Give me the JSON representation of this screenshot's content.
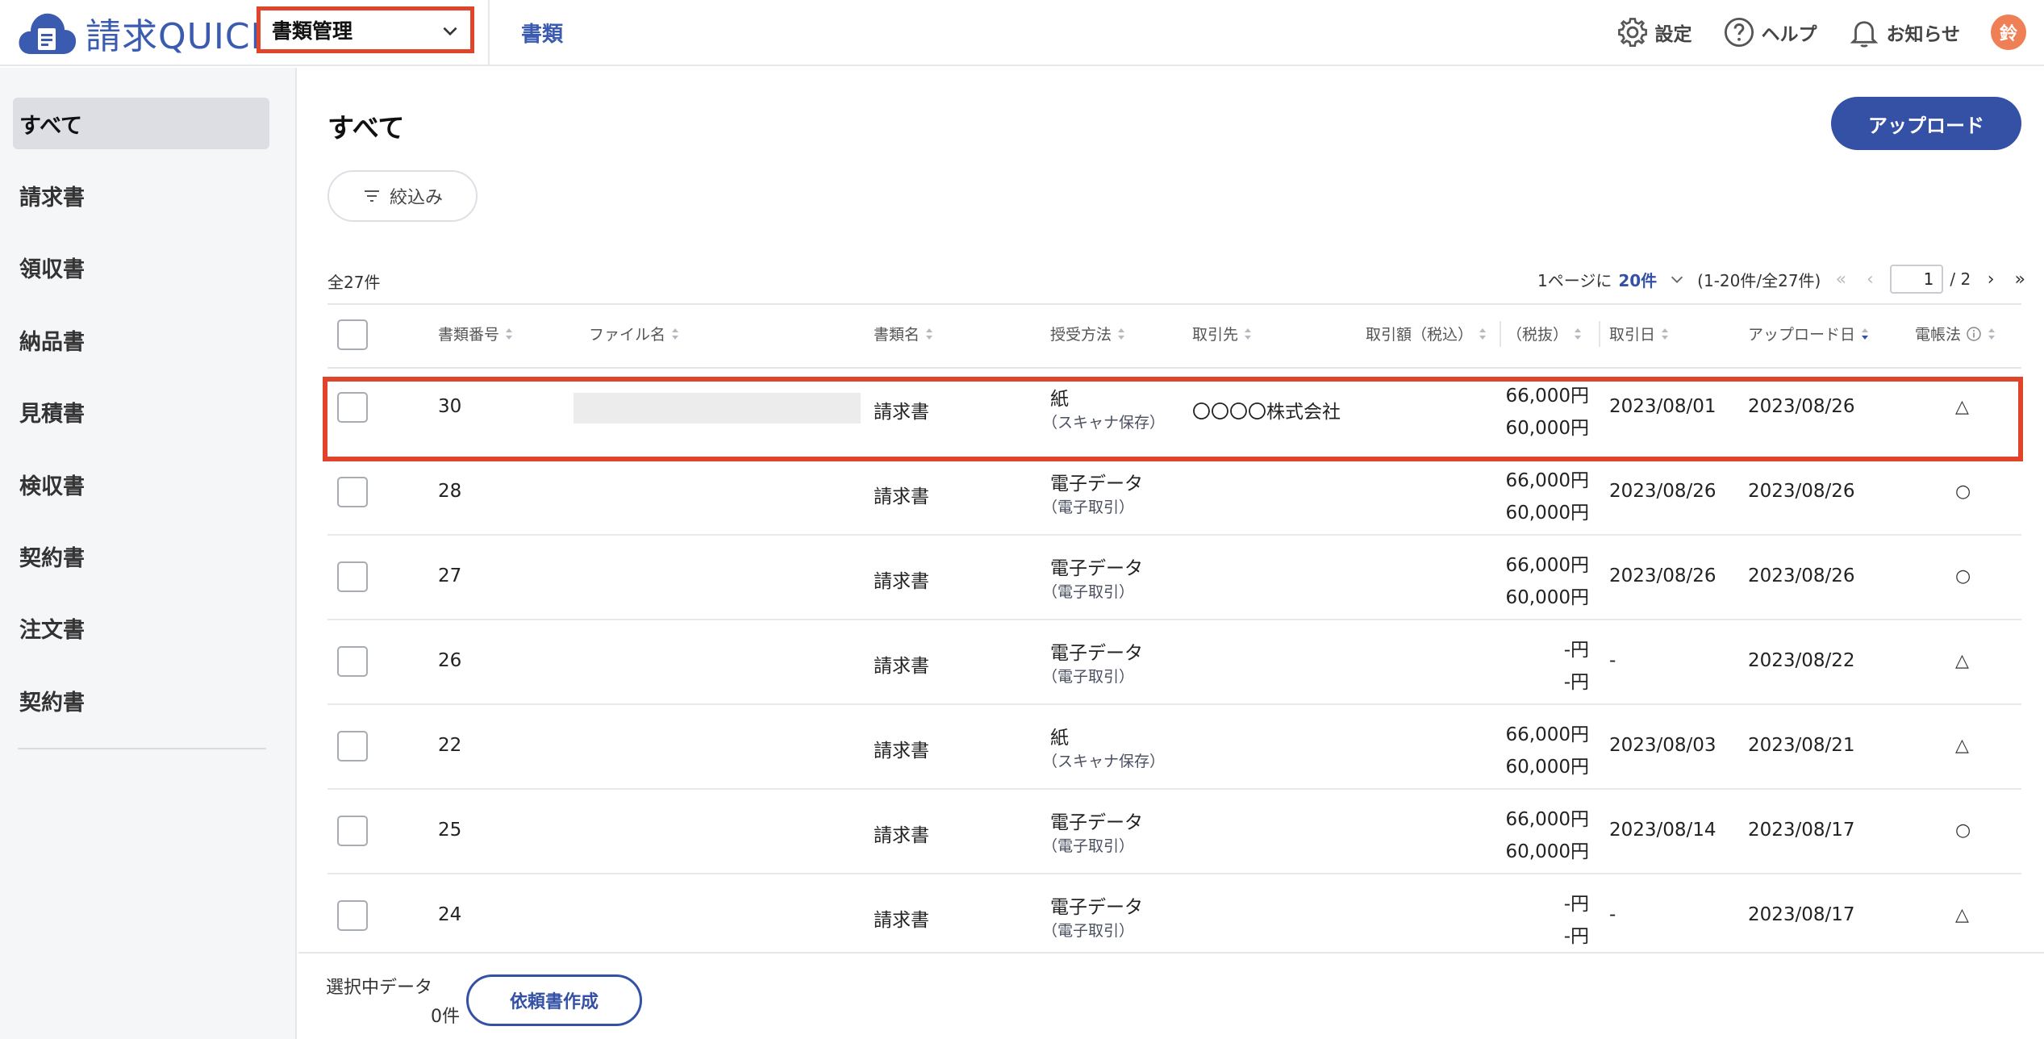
{
  "app": {
    "logo_text": "請求QUICK"
  },
  "header": {
    "module": "書類管理",
    "tab": "書類",
    "settings": "設定",
    "help": "ヘルプ",
    "notice": "お知らせ",
    "avatar": "鈴"
  },
  "sidebar": {
    "items": [
      "すべて",
      "請求書",
      "領収書",
      "納品書",
      "見積書",
      "検収書",
      "契約書",
      "注文書",
      "契約書"
    ],
    "active_index": 0
  },
  "main": {
    "title": "すべて",
    "upload_label": "アップロード",
    "filter_label": "絞込み",
    "total": "全27件"
  },
  "pager": {
    "per_page_prefix": "1ページに",
    "per_page": "20件",
    "range": "(1-20件/全27件)",
    "current_page": "1",
    "total_pages": "/ 2"
  },
  "table": {
    "headers": {
      "number": "書類番号",
      "file": "ファイル名",
      "doc_type": "書類名",
      "method": "授受方法",
      "partner": "取引先",
      "amount_tax": "取引額（税込）",
      "amount_notax": "（税抜）",
      "trade_date": "取引日",
      "upload_date": "アップロード日",
      "dencho": "電帳法"
    },
    "rows": [
      {
        "number": "30",
        "doc_type": "請求書",
        "method": "紙",
        "method_sub": "（スキャナ保存）",
        "partner": "〇〇〇〇株式会社",
        "amount_tax": "66,000円",
        "amount_notax": "60,000円",
        "trade_date": "2023/08/01",
        "upload_date": "2023/08/26",
        "dencho": "△"
      },
      {
        "number": "28",
        "doc_type": "請求書",
        "method": "電子データ",
        "method_sub": "（電子取引）",
        "partner": "",
        "amount_tax": "66,000円",
        "amount_notax": "60,000円",
        "trade_date": "2023/08/26",
        "upload_date": "2023/08/26",
        "dencho": "○"
      },
      {
        "number": "27",
        "doc_type": "請求書",
        "method": "電子データ",
        "method_sub": "（電子取引）",
        "partner": "",
        "amount_tax": "66,000円",
        "amount_notax": "60,000円",
        "trade_date": "2023/08/26",
        "upload_date": "2023/08/26",
        "dencho": "○"
      },
      {
        "number": "26",
        "doc_type": "請求書",
        "method": "電子データ",
        "method_sub": "（電子取引）",
        "partner": "",
        "amount_tax": "-円",
        "amount_notax": "-円",
        "trade_date": "-",
        "upload_date": "2023/08/22",
        "dencho": "△"
      },
      {
        "number": "22",
        "doc_type": "請求書",
        "method": "紙",
        "method_sub": "（スキャナ保存）",
        "partner": "",
        "amount_tax": "66,000円",
        "amount_notax": "60,000円",
        "trade_date": "2023/08/03",
        "upload_date": "2023/08/21",
        "dencho": "△"
      },
      {
        "number": "25",
        "doc_type": "請求書",
        "method": "電子データ",
        "method_sub": "（電子取引）",
        "partner": "",
        "amount_tax": "66,000円",
        "amount_notax": "60,000円",
        "trade_date": "2023/08/14",
        "upload_date": "2023/08/17",
        "dencho": "○"
      },
      {
        "number": "24",
        "doc_type": "請求書",
        "method": "電子データ",
        "method_sub": "（電子取引）",
        "partner": "",
        "amount_tax": "-円",
        "amount_notax": "-円",
        "trade_date": "-",
        "upload_date": "2023/08/17",
        "dencho": "△"
      }
    ]
  },
  "footer": {
    "selected_label": "選択中データ",
    "selected_count": "0件",
    "request_label": "依頼書作成"
  },
  "colors": {
    "brand": "#3451a6",
    "highlight": "#e0442a",
    "avatar": "#ef7f55"
  }
}
